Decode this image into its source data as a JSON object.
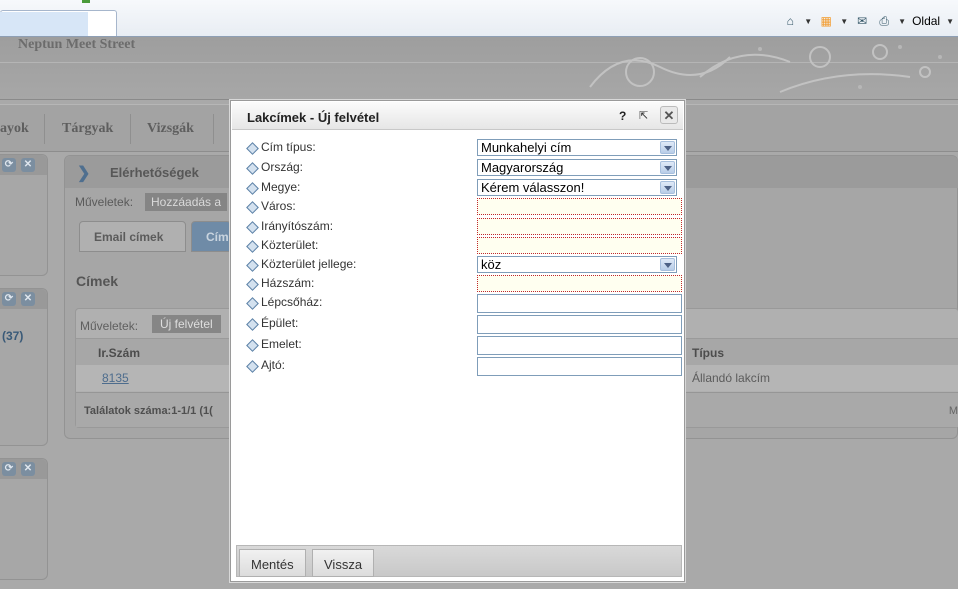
{
  "browser": {
    "page_label": "Oldal"
  },
  "app": {
    "title": "Neptun Meet Street",
    "nav": [
      "ayok",
      "Tárgyak",
      "Vizsgák"
    ]
  },
  "left_panels": {
    "count": "(37)"
  },
  "main": {
    "title": "Elérhetőségek",
    "ops_label": "Műveletek:",
    "ops_button": "Hozzáadás a",
    "tabs": [
      "Email címek",
      "Cím"
    ],
    "section_title": "Címek",
    "grid": {
      "ops_label": "Műveletek:",
      "add_button": "Új felvétel",
      "columns": [
        "Ir.Szám",
        "Típus"
      ],
      "rows": [
        {
          "zip": "8135",
          "type": "Állandó lakcím"
        }
      ],
      "footer": "Találatok száma:1-1/1 (1(",
      "footer_right": "M"
    }
  },
  "modal": {
    "title": "Lakcímek - Új felvétel",
    "help": "?",
    "popout": "⇱",
    "close": "✕",
    "fields": [
      {
        "label": "Cím típus:",
        "type": "select",
        "value": "Munkahelyi cím"
      },
      {
        "label": "Ország:",
        "type": "select",
        "value": "Magyarország"
      },
      {
        "label": "Megye:",
        "type": "select",
        "value": "Kérem válasszon!"
      },
      {
        "label": "Város:",
        "type": "input",
        "required": true,
        "value": ""
      },
      {
        "label": "Irányítószám:",
        "type": "input",
        "required": true,
        "value": ""
      },
      {
        "label": "Közterület:",
        "type": "input",
        "required": true,
        "value": ""
      },
      {
        "label": "Közterület jellege:",
        "type": "select",
        "value": "köz"
      },
      {
        "label": "Házszám:",
        "type": "input",
        "required": true,
        "value": ""
      },
      {
        "label": "Lépcsőház:",
        "type": "input",
        "required": false,
        "value": ""
      },
      {
        "label": "Épület:",
        "type": "input",
        "required": false,
        "value": ""
      },
      {
        "label": "Emelet:",
        "type": "input",
        "required": false,
        "value": ""
      },
      {
        "label": "Ajtó:",
        "type": "input",
        "required": false,
        "value": ""
      }
    ],
    "buttons": {
      "save": "Mentés",
      "back": "Vissza"
    }
  }
}
